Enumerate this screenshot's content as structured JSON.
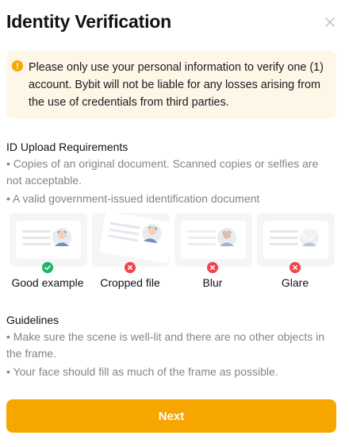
{
  "modal": {
    "title": "Identity Verification"
  },
  "notice": {
    "text": "Please only use your personal information to verify one (1) account. Bybit will not be liable for any losses arising from the use of credentials from third parties.",
    "color": "#fef6e7",
    "icon": "warning-icon"
  },
  "requirements": {
    "title": "ID Upload Requirements",
    "bullets": [
      "• Copies of an original document. Scanned copies or selfies are not acceptable.",
      "• A valid government-issued identification document"
    ]
  },
  "examples": [
    {
      "label": "Good example",
      "status": "ok",
      "status_icon": "check-circle-icon"
    },
    {
      "label": "Cropped file",
      "status": "bad",
      "status_icon": "error-circle-icon"
    },
    {
      "label": "Blur",
      "status": "bad",
      "status_icon": "error-circle-icon"
    },
    {
      "label": "Glare",
      "status": "bad",
      "status_icon": "error-circle-icon"
    }
  ],
  "guidelines": {
    "title": "Guidelines",
    "bullets": [
      "• Make sure the scene is well-lit and there are no other objects in the frame.",
      "• Your face should fill as much of the frame as possible."
    ]
  },
  "actions": {
    "next_label": "Next"
  },
  "colors": {
    "accent": "#f7a600",
    "success": "#20b26c",
    "error": "#ef454a",
    "muted_text": "#81858c"
  }
}
